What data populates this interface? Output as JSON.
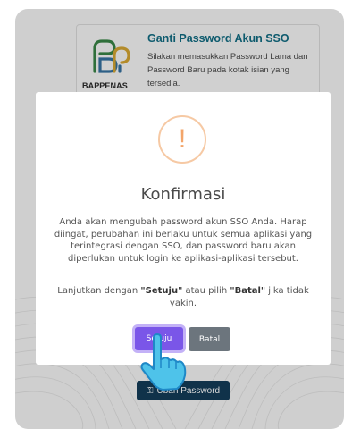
{
  "colors": {
    "accent": "#7a56e8",
    "cancel": "#6c757d",
    "warning": "#f3a56a",
    "title_teal": "#0e5b6e",
    "overlay": "#cfcfcf"
  },
  "info": {
    "logo_text": "BAPPENAS",
    "title": "Ganti Password Akun SSO",
    "description": "Silakan memasukkan Password Lama dan Password Baru pada kotak isian yang tersedia."
  },
  "background_button": {
    "label": "Ubah Password",
    "icon": "key-icon"
  },
  "dialog": {
    "icon": "exclamation-icon",
    "title": "Konfirmasi",
    "message": "Anda akan mengubah password akun SSO Anda. Harap diingat, perubahan ini berlaku untuk semua aplikasi yang terintegrasi dengan SSO, dan password baru akan diperlukan untuk login ke aplikasi-aplikasi tersebut.",
    "prompt_prefix": "Lanjutkan dengan ",
    "prompt_ok": "\"Setuju\"",
    "prompt_middle": " atau pilih ",
    "prompt_cancel": "\"Batal\"",
    "prompt_suffix": " jika tidak yakin.",
    "confirm_label": "Setuju",
    "cancel_label": "Batal"
  },
  "cursor": "hand-pointer-icon"
}
